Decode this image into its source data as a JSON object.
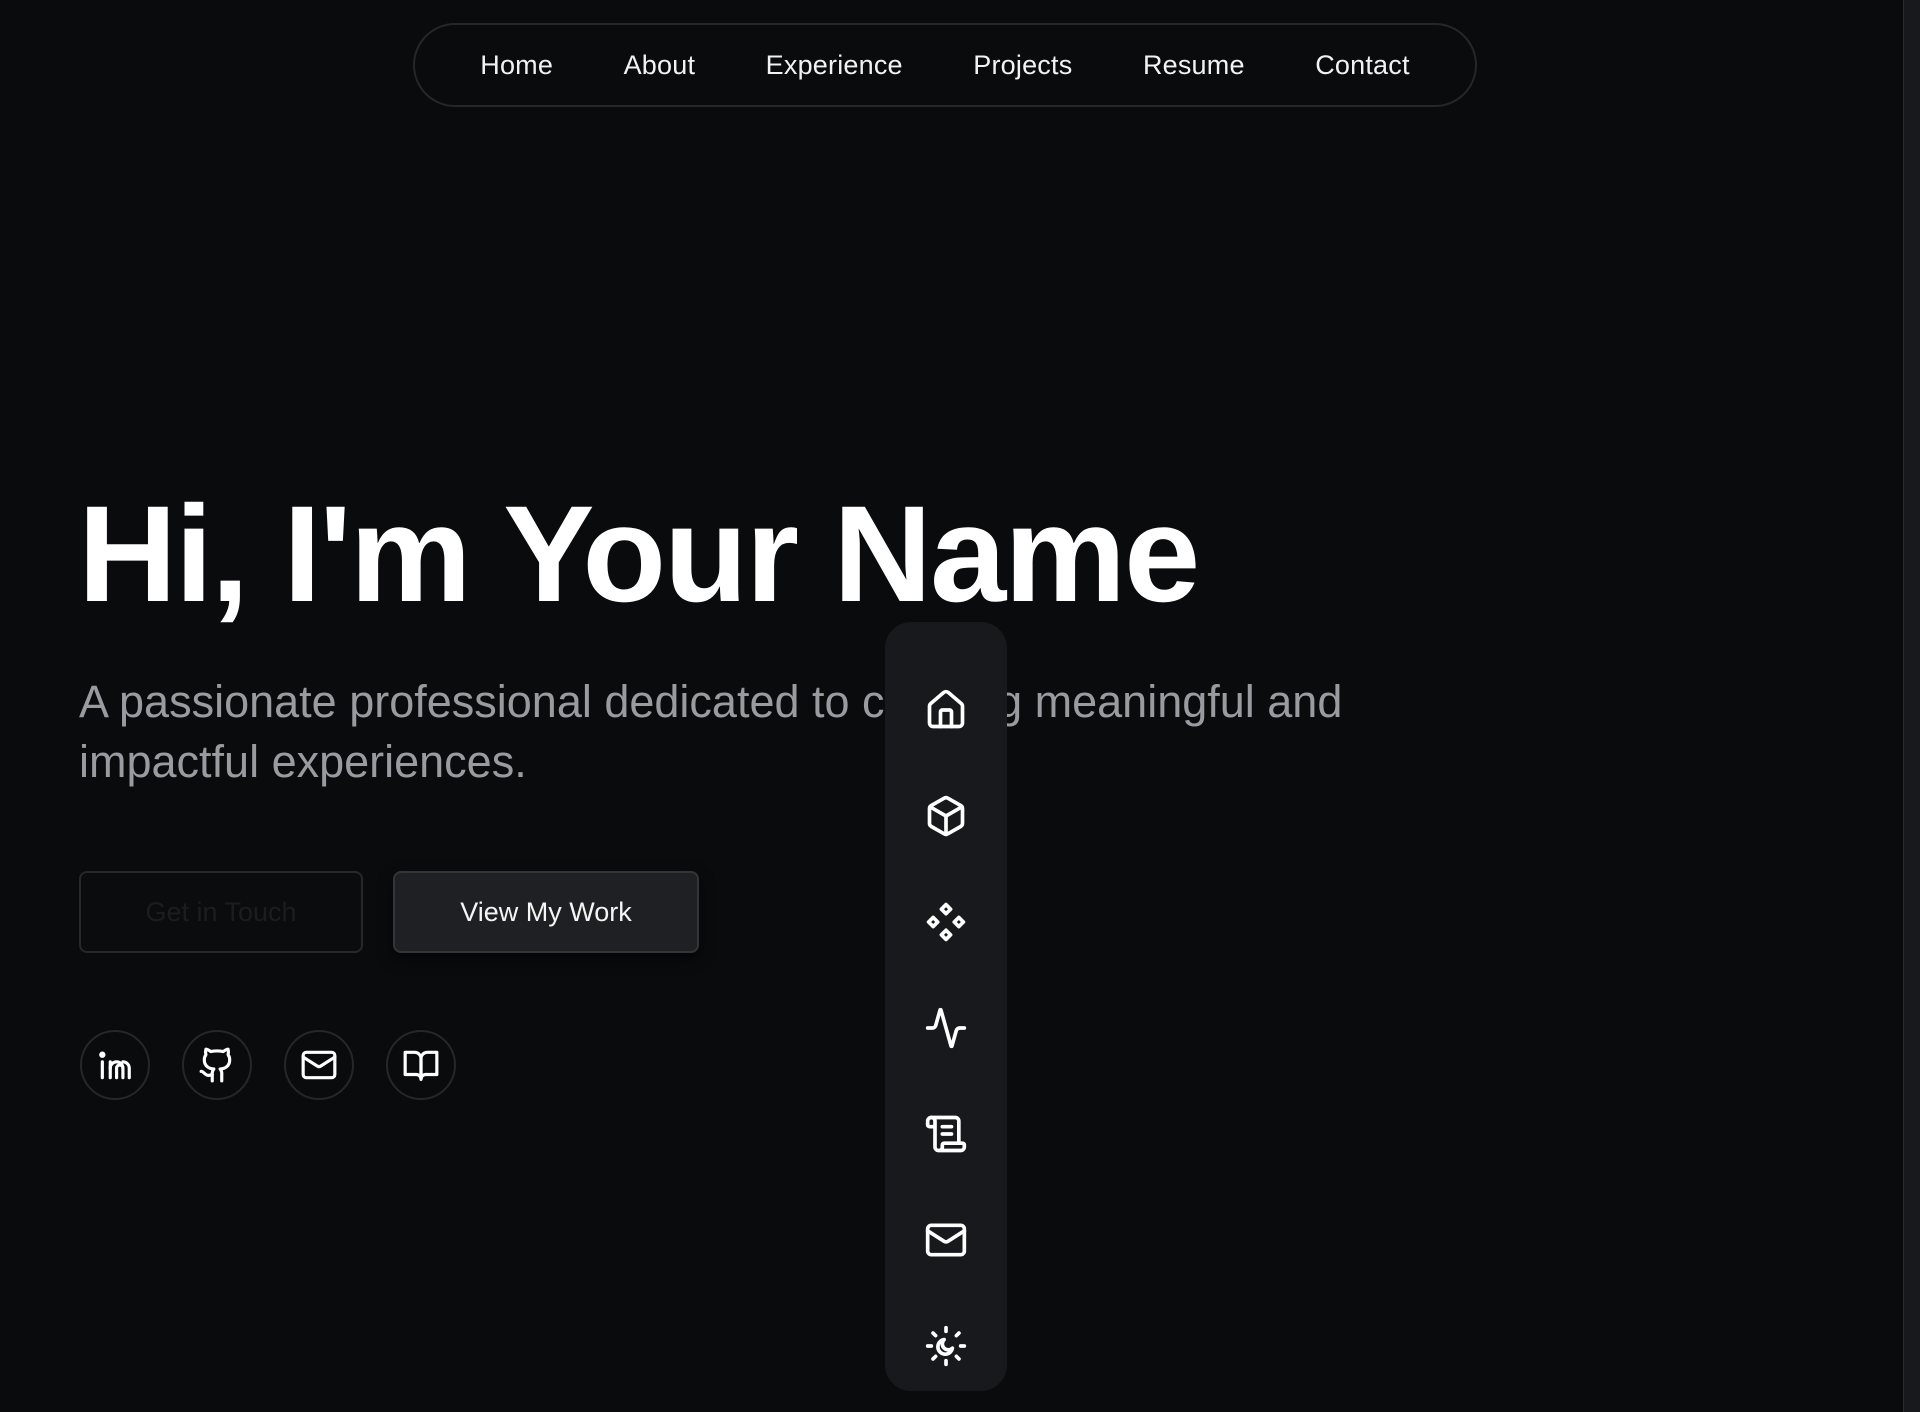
{
  "nav": {
    "items": [
      {
        "label": "Home"
      },
      {
        "label": "About"
      },
      {
        "label": "Experience"
      },
      {
        "label": "Projects"
      },
      {
        "label": "Resume"
      },
      {
        "label": "Contact"
      }
    ]
  },
  "hero": {
    "title": "Hi, I'm Your Name",
    "subtitle": "A passionate professional dedicated to creating meaningful and impactful experiences.",
    "buttons": {
      "primary": "Get in Touch",
      "secondary": "View My Work"
    }
  },
  "social": {
    "icons": [
      "linkedin-icon",
      "github-icon",
      "mail-icon",
      "book-icon"
    ]
  },
  "dock": {
    "icons": [
      "home-icon",
      "box-icon",
      "components-icon",
      "activity-icon",
      "scroll-icon",
      "mail-icon",
      "theme-toggle-icon"
    ]
  },
  "colors": {
    "background": "#0a0b0d",
    "text": "#ffffff",
    "muted_text": "#9a9ba1",
    "dock_background": "#18191c",
    "border": "#26272b"
  }
}
